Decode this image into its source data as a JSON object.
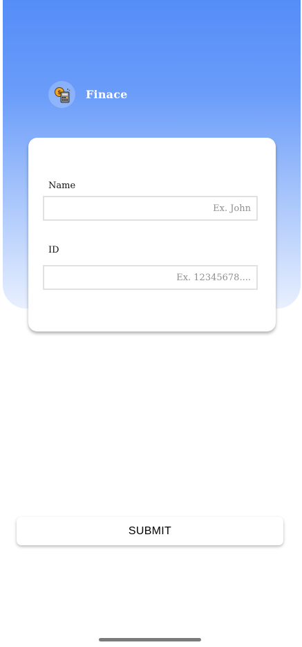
{
  "header": {
    "app_name": "Finace",
    "logo_icon": "calculator-coin-icon",
    "gradient_top": "#558df8",
    "gradient_bottom": "#e9f0fe"
  },
  "form": {
    "name": {
      "label": "Name",
      "value": "",
      "placeholder": "Ex. John"
    },
    "id": {
      "label": "ID",
      "value": "",
      "placeholder": "Ex. 12345678...."
    }
  },
  "actions": {
    "submit_label": "SUBMIT"
  }
}
